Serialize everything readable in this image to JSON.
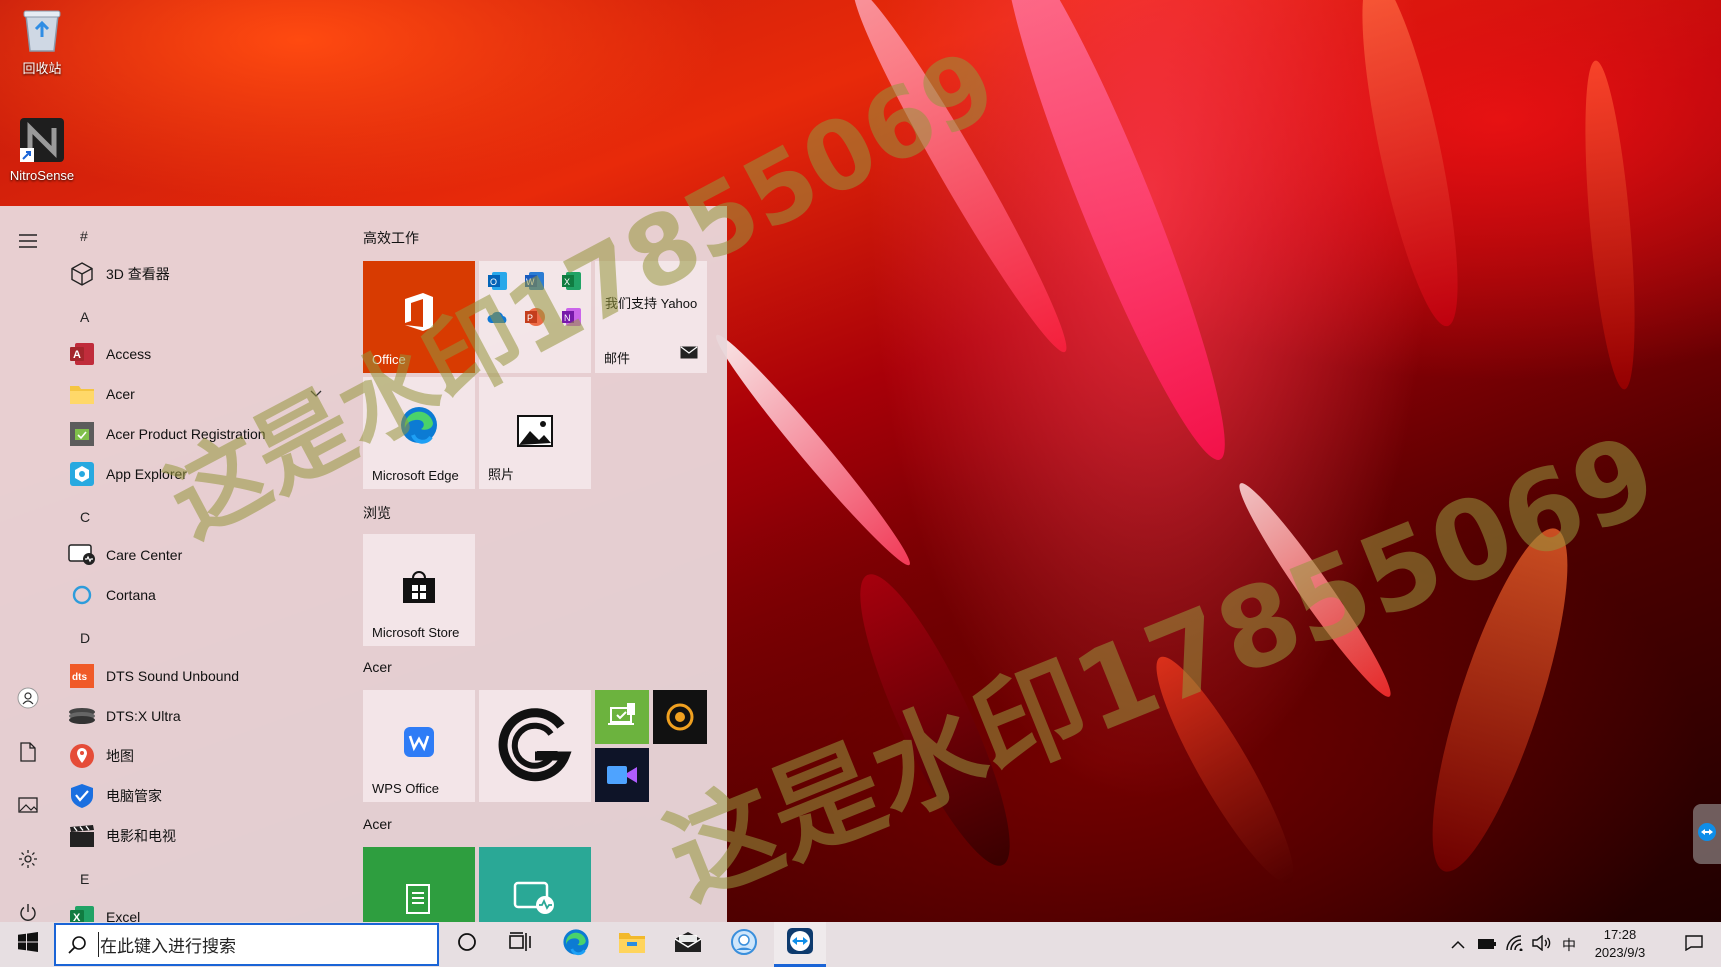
{
  "desktop": {
    "icons": [
      {
        "label": "回收站",
        "icon": "recycle-bin-icon"
      },
      {
        "label": "NitroSense",
        "icon": "nitrosense-icon"
      }
    ]
  },
  "watermark": {
    "text": "这是水印17855069"
  },
  "start_menu": {
    "rail": {
      "menu": "hamburger-icon",
      "user": "user-icon",
      "documents": "document-icon",
      "pictures": "pictures-icon",
      "settings": "gear-icon",
      "power": "power-icon"
    },
    "app_list": [
      {
        "type": "letter",
        "text": "#"
      },
      {
        "type": "app",
        "label": "3D 查看器",
        "icon": "3d-viewer-icon"
      },
      {
        "type": "letter",
        "text": "A"
      },
      {
        "type": "app",
        "label": "Access",
        "icon": "access-icon"
      },
      {
        "type": "app",
        "label": "Acer",
        "icon": "folder-icon",
        "expandable": true
      },
      {
        "type": "app",
        "label": "Acer Product Registration",
        "icon": "registration-icon"
      },
      {
        "type": "app",
        "label": "App Explorer",
        "icon": "app-explorer-icon"
      },
      {
        "type": "letter",
        "text": "C"
      },
      {
        "type": "app",
        "label": "Care Center",
        "icon": "care-center-icon"
      },
      {
        "type": "app",
        "label": "Cortana",
        "icon": "cortana-icon"
      },
      {
        "type": "letter",
        "text": "D"
      },
      {
        "type": "app",
        "label": "DTS Sound Unbound",
        "icon": "dts-icon"
      },
      {
        "type": "app",
        "label": "DTS:X Ultra",
        "icon": "dtsx-icon"
      },
      {
        "type": "app",
        "label": "地图",
        "icon": "maps-icon"
      },
      {
        "type": "app",
        "label": "电脑管家",
        "icon": "pc-manager-icon"
      },
      {
        "type": "app",
        "label": "电影和电视",
        "icon": "movies-icon"
      },
      {
        "type": "letter",
        "text": "E"
      },
      {
        "type": "app",
        "label": "Excel",
        "icon": "excel-icon"
      }
    ],
    "tile_groups": {
      "g1": "高效工作",
      "g2": "浏览",
      "g3": "Acer",
      "g4": "Acer"
    },
    "tiles": {
      "office": "Office",
      "yahoo_text": "我们支持 Yahoo",
      "mail": "邮件",
      "edge": "Microsoft Edge",
      "photos": "照片",
      "store": "Microsoft Store",
      "wps": "WPS Office"
    }
  },
  "taskbar": {
    "search_placeholder": "在此键入进行搜索",
    "tray_ime": "中",
    "clock_time": "17:28",
    "clock_date": "2023/9/3"
  },
  "colors": {
    "accent": "#1a64d6",
    "office_tile": "#d83b01",
    "green_tile": "#2e9e3f",
    "teal_tile": "#2aa896"
  }
}
